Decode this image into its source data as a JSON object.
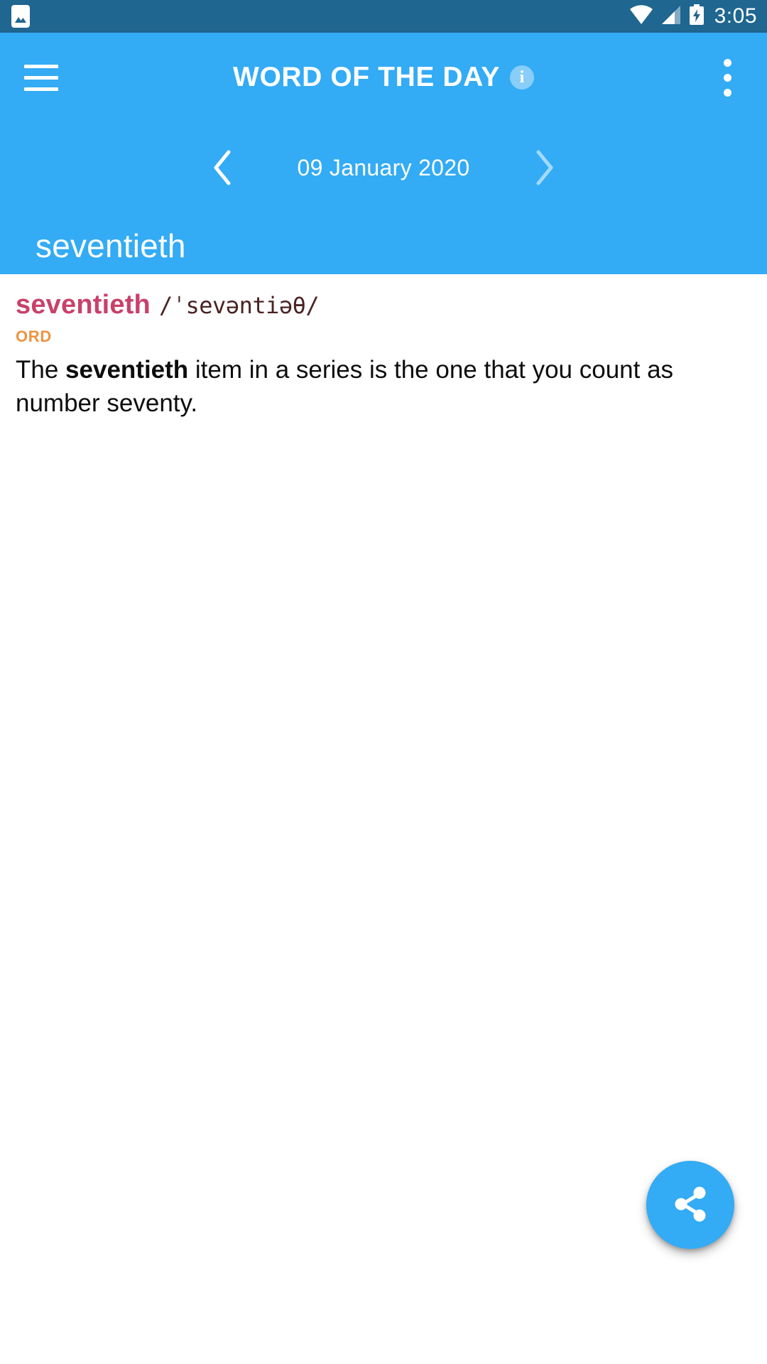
{
  "statusbar": {
    "notification_icon": "screenshot-image-icon",
    "wifi_icon": "wifi-icon",
    "signal_icon": "cellular-signal-icon",
    "battery_icon": "battery-charging-icon",
    "time": "3:05",
    "background_color": "#1f6690"
  },
  "appbar": {
    "menu_icon": "hamburger-menu-icon",
    "title": "WORD OF THE DAY",
    "info_icon": "info-icon",
    "info_glyph": "i",
    "overflow_icon": "more-vert-icon",
    "background_color": "#33abf5"
  },
  "date_nav": {
    "prev_icon": "chevron-left-icon",
    "next_icon": "chevron-right-icon",
    "date": "09 January 2020"
  },
  "header_word": {
    "word": "seventieth"
  },
  "entry": {
    "headword": "seventieth",
    "headword_color": "#c9416b",
    "pronunciation": "/ˈsevəntiəθ/",
    "part_of_speech": "ORD",
    "part_of_speech_color": "#ef9340",
    "definition_pre": "The ",
    "definition_bold": "seventieth",
    "definition_post": " item in a series is the one that you count as number seventy."
  },
  "fab": {
    "icon": "share-icon",
    "background_color": "#33abf5"
  }
}
